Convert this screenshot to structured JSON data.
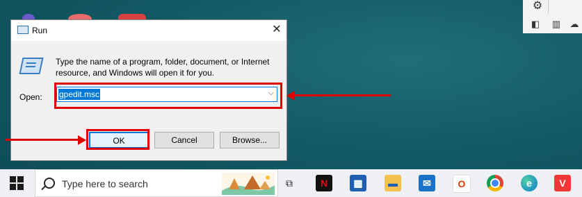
{
  "dialog": {
    "title": "Run",
    "close_glyph": "✕",
    "description": "Type the name of a program, folder, document, or Internet resource, and Windows will open it for you.",
    "open_label": "Open:",
    "open_value": "gpedit.msc",
    "ok_label": "OK",
    "cancel_label": "Cancel",
    "browse_label": "Browse..."
  },
  "taskbar": {
    "search_placeholder": "Type here to search",
    "apps": [
      "task-view",
      "netflix",
      "microsoft-store",
      "file-explorer",
      "mail",
      "office",
      "chrome",
      "edge",
      "vivaldi"
    ]
  },
  "side_panel": {
    "icons": [
      "gear-icon",
      "panel-icon",
      "reader-icon",
      "cloud-icon"
    ]
  },
  "colors": {
    "highlight_red": "#e00000",
    "accent_blue": "#0078d7",
    "desktop_teal": "#135a66"
  }
}
